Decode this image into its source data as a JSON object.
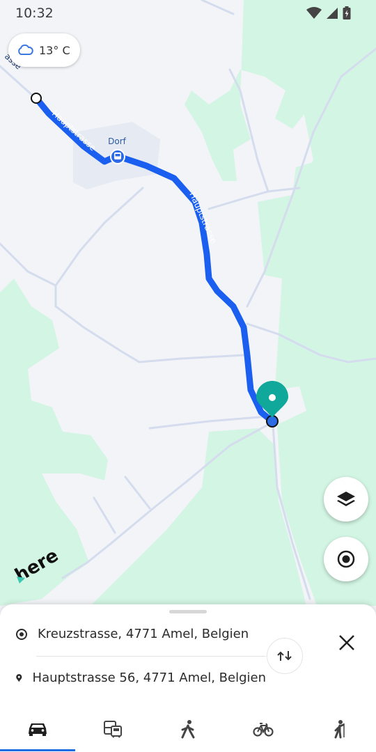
{
  "status_bar": {
    "time": "10:32"
  },
  "weather": {
    "temperature": "13° C",
    "icon": "cloud-icon"
  },
  "map": {
    "street_labels": [
      "asse",
      "Hauptstrasse",
      "Hauptstrasse"
    ],
    "poi_label": "Dorf",
    "brand_logo": "here",
    "colors": {
      "route": "#1a5ff0",
      "forest": "#d3f5e3",
      "land": "#f2f4f8",
      "road": "#d4dced",
      "destination_pin": "#10a89a"
    }
  },
  "route": {
    "origin": "Kreuzstrasse, 4771 Amel, Belgien",
    "destination": "Hauptstrasse 56, 4771 Amel, Belgien"
  },
  "transport_modes": [
    {
      "name": "car",
      "icon": "car-icon",
      "active": true
    },
    {
      "name": "public-transport",
      "icon": "public-transport-icon",
      "active": false
    },
    {
      "name": "walk",
      "icon": "walk-icon",
      "active": false
    },
    {
      "name": "bicycle",
      "icon": "bicycle-icon",
      "active": false
    },
    {
      "name": "hiking",
      "icon": "hiking-icon",
      "active": false
    }
  ],
  "buttons": {
    "layers": "layers-icon",
    "locate": "locate-icon",
    "swap": "swap-icon",
    "close": "close-icon"
  }
}
